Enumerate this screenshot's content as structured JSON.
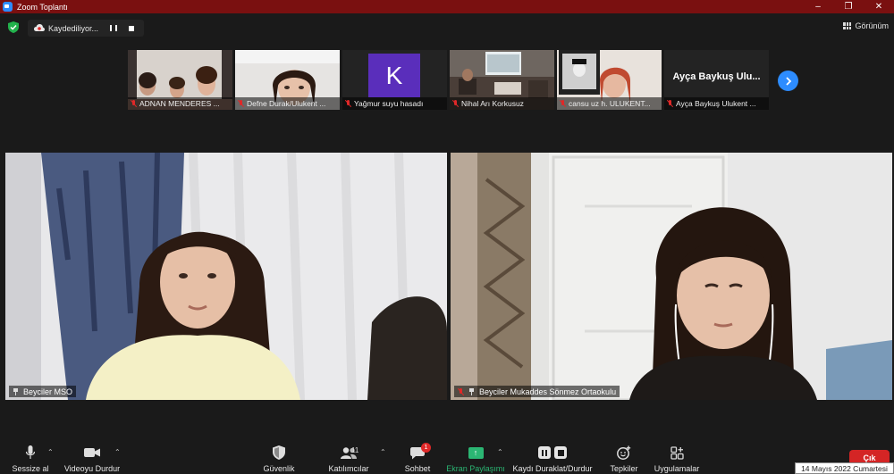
{
  "window": {
    "title": "Zoom Toplantı",
    "buttons": [
      "–",
      "❐",
      "✕"
    ]
  },
  "recording": {
    "status": "Kaydediliyor..."
  },
  "view_button": {
    "label": "Görünüm"
  },
  "thumbnails": [
    {
      "name": "ADNAN MENDERES ..."
    },
    {
      "name": "Defne Durak/Ulukent ..."
    },
    {
      "name": "Yağmur suyu hasadı",
      "avatar_letter": "K",
      "avatar_color": "#5a2ebb"
    },
    {
      "name": "Nihal Arı Korkusuz"
    },
    {
      "name": "cansu uz h. ULUKENT..."
    },
    {
      "name": "Ayça Baykuş Ulukent ...",
      "display_text": "Ayça Baykuş Ulu..."
    }
  ],
  "main_videos": [
    {
      "name": "Beyciler MSO"
    },
    {
      "name": "Beyciler Mukaddes Sönmez Ortaokulu"
    }
  ],
  "toolbar": {
    "mute": "Sessize al",
    "video": "Videoyu Durdur",
    "security": "Güvenlik",
    "participants": "Katılımcılar",
    "participants_count": "11",
    "chat": "Sohbet",
    "chat_badge": "1",
    "share": "Ekran Paylaşımı",
    "record": "Kaydı Duraklat/Durdur",
    "reactions": "Tepkiler",
    "apps": "Uygulamalar",
    "leave": "Çık"
  },
  "taskbar_date": "14 Mayıs 2022 Cumartesi",
  "colors": {
    "titlebar": "#7a1010",
    "accent_blue": "#2d8cff",
    "share_green": "#2bb673",
    "leave_red": "#d42525",
    "muted_red": "#e02828"
  }
}
